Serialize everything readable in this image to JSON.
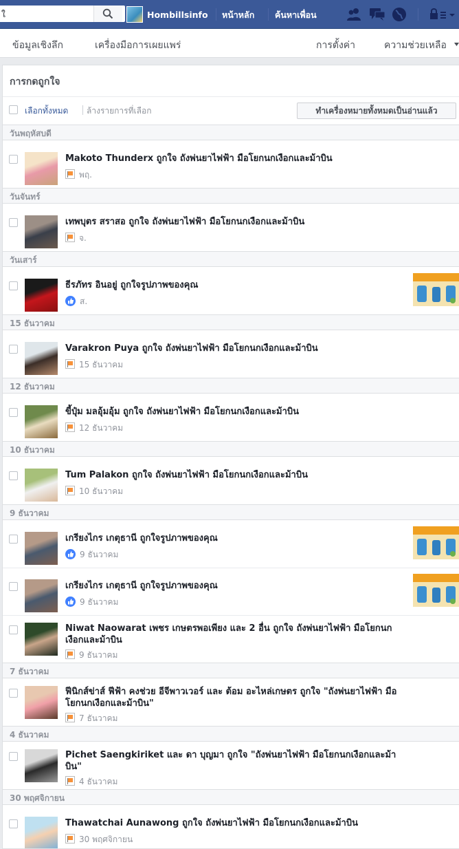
{
  "topbar": {
    "search_value": "ใ",
    "profile_name": "Hombillsinfo",
    "home_label": "หน้าหลัก",
    "find_friends_label": "ค้นหาเพื่อน"
  },
  "subnav": {
    "insights": "ข้อมูลเชิงลึก",
    "publishing_tools": "เครื่องมือการเผยแพร่",
    "settings": "การตั้งค่า",
    "help": "ความช่วยเหลือ"
  },
  "panel": {
    "title": "การกดถูกใจ",
    "select_all": "เลือกทั้งหมด",
    "clear_selection": "ล้างรายการที่เลือก",
    "mark_all_read": "ทำเครื่องหมายทั้งหมดเป็นอ่านแล้ว"
  },
  "groups": [
    {
      "date": "วันพฤหัสบดี",
      "items": [
        {
          "text": "Makoto Thunderx ถูกใจ ถังพ่นยาไฟฟ้า มือโยกนกเงือกและม้าบิน",
          "time": "พฤ.",
          "type": "page",
          "avatar": [
            "#f5e3c8",
            "#e89aa8",
            "#c9a37a"
          ],
          "thumb": false
        }
      ]
    },
    {
      "date": "วันจันทร์",
      "items": [
        {
          "text": "เทพบุตร สราสอ ถูกใจ ถังพ่นยาไฟฟ้า มือโยกนกเงือกและม้าบิน",
          "time": "จ.",
          "type": "page",
          "avatar": [
            "#9c8f86",
            "#3a3f4a",
            "#6b5a4e"
          ],
          "thumb": false
        }
      ]
    },
    {
      "date": "วันเสาร์",
      "items": [
        {
          "text": "ธีรภัทร อินอยู่ ถูกใจรูปภาพของคุณ",
          "time": "ส.",
          "type": "like",
          "avatar": [
            "#1a1a1a",
            "#c4161c",
            "#8a1010"
          ],
          "thumb": true
        }
      ]
    },
    {
      "date": "15 ธันวาคม",
      "items": [
        {
          "text": "Varakron Puya ถูกใจ ถังพ่นยาไฟฟ้า มือโยกนกเงือกและม้าบิน",
          "time": "15 ธันวาคม",
          "type": "page",
          "avatar": [
            "#dfe6ea",
            "#3b2e28",
            "#b58a6c"
          ],
          "thumb": false
        }
      ]
    },
    {
      "date": "12 ธันวาคม",
      "items": [
        {
          "text": "ขี้ปุ๋ม มลอุ้มอุ้ม ถูกใจ ถังพ่นยาไฟฟ้า มือโยกนกเงือกและม้าบิน",
          "time": "12 ธันวาคม",
          "type": "page",
          "avatar": [
            "#6f8a4c",
            "#e9dcc0",
            "#8a6a3c"
          ],
          "thumb": false
        }
      ]
    },
    {
      "date": "10 ธันวาคม",
      "items": [
        {
          "text": "Tum Palakon ถูกใจ ถังพ่นยาไฟฟ้า มือโยกนกเงือกและม้าบิน",
          "time": "10 ธันวาคม",
          "type": "page",
          "avatar": [
            "#a7c07a",
            "#f0f0f0",
            "#d9b89a"
          ],
          "thumb": false
        }
      ]
    },
    {
      "date": "9 ธันวาคม",
      "items": [
        {
          "text": "เกรียงไกร เกตุธานี ถูกใจรูปภาพของคุณ",
          "time": "9 ธันวาคม",
          "type": "like",
          "avatar": [
            "#b59a88",
            "#4a5a6e",
            "#7d5f50"
          ],
          "thumb": true
        },
        {
          "text": "เกรียงไกร เกตุธานี ถูกใจรูปภาพของคุณ",
          "time": "9 ธันวาคม",
          "type": "like",
          "avatar": [
            "#b59a88",
            "#4a5a6e",
            "#7d5f50"
          ],
          "thumb": true
        },
        {
          "text": "Niwat Naowarat เพชร เกษตรพอเพียง และ 2 อื่น ถูกใจ ถังพ่นยาไฟฟ้า มือโยกนกเงือกและม้าบิน",
          "time": "9 ธันวาคม",
          "type": "page",
          "avatar": [
            "#2e4a2a",
            "#c9a58a",
            "#1f2a1f"
          ],
          "thumb": false
        }
      ]
    },
    {
      "date": "7 ธันวาคม",
      "items": [
        {
          "text": "ฟีนิกส์ข่าส์ ฟีฟ้า คงช่วย อีจีพาวเวอร์ และ ต้อม อะไหล่เกษตร ถูกใจ \"ถังพ่นยาไฟฟ้า มือโยกนกเงือกและม้าบิน\"",
          "time": "7 ธันวาคม",
          "type": "page",
          "avatar": [
            "#e8c8b0",
            "#f0a0a8",
            "#5a3a2a"
          ],
          "thumb": false
        }
      ]
    },
    {
      "date": "4 ธันวาคม",
      "items": [
        {
          "text": "Pichet Saengkiriket และ ดา บุญมา ถูกใจ \"ถังพ่นยาไฟฟ้า มือโยกนกเงือกและม้าบิน\"",
          "time": "4 ธันวาคม",
          "type": "page",
          "avatar": [
            "#d8d8d8",
            "#2a2a2a",
            "#9a9a9a"
          ],
          "thumb": false
        }
      ]
    },
    {
      "date": "30 พฤศจิกายน",
      "items": [
        {
          "text": "Thawatchai Aunawong ถูกใจ ถังพ่นยาไฟฟ้า มือโยกนกเงือกและม้าบิน",
          "time": "30 พฤศจิกายน",
          "type": "page",
          "avatar": [
            "#bfe0f0",
            "#f5d0b0",
            "#7ab0d8"
          ],
          "thumb": false
        }
      ]
    }
  ],
  "colors": {
    "brand": "#3b5998",
    "link": "#365899",
    "like_blue": "#4080ff",
    "page_flag": "#f7923a"
  }
}
